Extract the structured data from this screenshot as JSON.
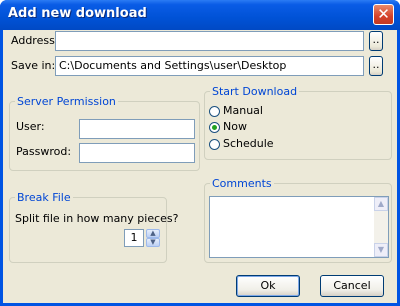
{
  "window": {
    "title": "Add new download",
    "close_glyph": "✕"
  },
  "address": {
    "label": "Address:",
    "value": "",
    "browse_label": ".."
  },
  "save_in": {
    "label": "Save in:",
    "value": "C:\\Documents and Settings\\user\\Desktop",
    "browse_label": ".."
  },
  "server_permission": {
    "legend": "Server Permission",
    "user_label": "User:",
    "user_value": "",
    "password_label": "Passwrod:",
    "password_value": ""
  },
  "start_download": {
    "legend": "Start Download",
    "options": [
      {
        "label": "Manual",
        "selected": false
      },
      {
        "label": "Now",
        "selected": true
      },
      {
        "label": "Schedule",
        "selected": false
      }
    ]
  },
  "comments": {
    "legend": "Comments",
    "value": ""
  },
  "break_file": {
    "legend": "Break File",
    "question": "Split file in how many pieces?",
    "pieces": "1"
  },
  "buttons": {
    "ok": "Ok",
    "cancel": "Cancel"
  },
  "icons": {
    "close": "close-icon",
    "scroll_up": "scroll-up-icon",
    "scroll_down": "scroll-down-icon",
    "spin_up": "spin-up-icon",
    "spin_down": "spin-down-icon"
  },
  "colors": {
    "title_bar": "#0054e3",
    "dialog_bg": "#ece9d8",
    "group_legend": "#0046d5",
    "radio_dot": "#21a121"
  }
}
